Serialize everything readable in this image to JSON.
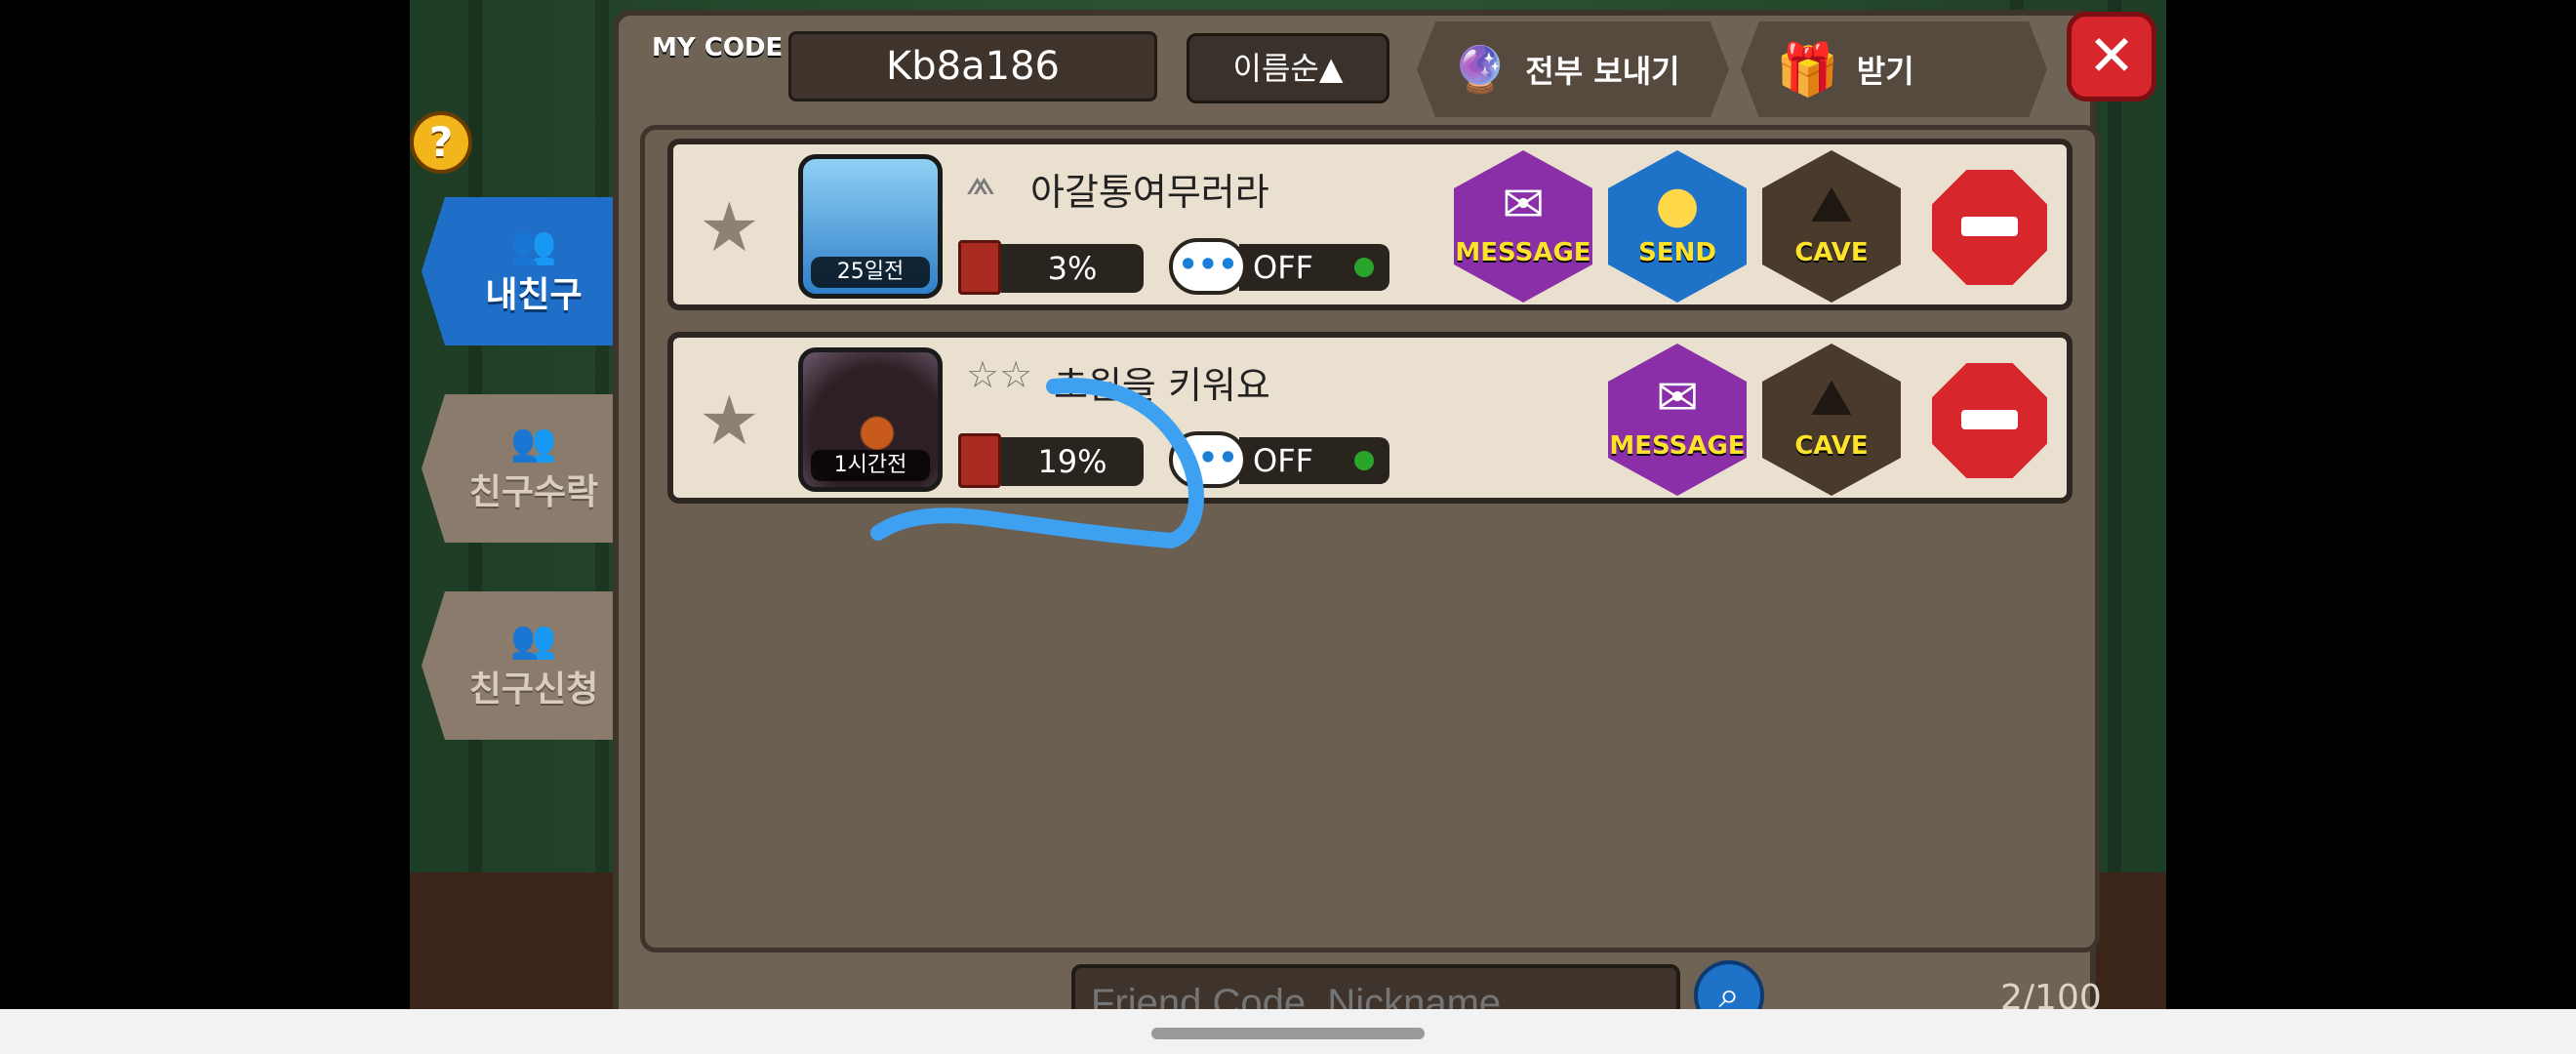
{
  "header": {
    "my_code_label": "MY CODE",
    "my_code_value": "Kb8a186",
    "sort_label": "이름순▲",
    "send_all_label": "전부 보내기",
    "receive_label": "받기",
    "close_icon": "close-x-icon"
  },
  "tabs": [
    {
      "label": "내친구",
      "icon": "friends-icon",
      "active": true
    },
    {
      "label": "친구수락",
      "icon": "friends-icon",
      "active": false
    },
    {
      "label": "친구신청",
      "icon": "friends-icon",
      "active": false
    }
  ],
  "help": {
    "glyph": "?"
  },
  "friends": [
    {
      "nickname": "아갈통여무러라",
      "last_login": "25일전",
      "progress": "3%",
      "chat_status": "OFF",
      "actions": [
        "MESSAGE",
        "SEND",
        "CAVE"
      ]
    },
    {
      "nickname": "초원을 키워요",
      "last_login": "1시간전",
      "progress": "19%",
      "chat_status": "OFF",
      "actions": [
        "MESSAGE",
        "CAVE"
      ]
    }
  ],
  "search": {
    "placeholder": "Friend Code, Nickname"
  },
  "friend_count": "2/100",
  "colors": {
    "tab_active": "#1f6fc8",
    "remove": "#d8262d",
    "message": "#8b2fa8",
    "send": "#1e72c8",
    "cave": "#4a3a2c",
    "online": "#2aa52c",
    "annotation": "#3ea0f0"
  }
}
